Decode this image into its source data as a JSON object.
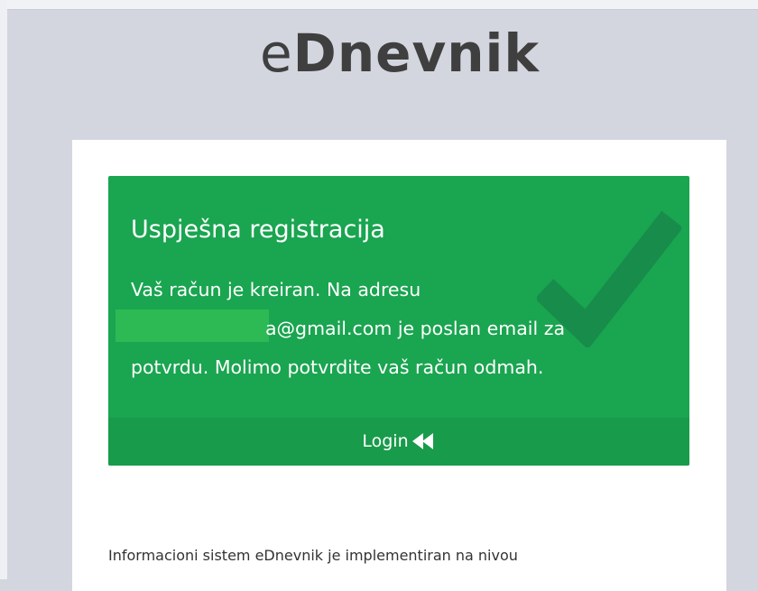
{
  "logo": {
    "prefix": "e",
    "name": "Dnevnik"
  },
  "alert": {
    "title": "Uspješna registracija",
    "message_line1": "Vaš račun je kreiran. Na adresu",
    "email_visible": "a@gmail.com",
    "message_line2_rest": " je poslan email za",
    "message_line3": "potvrdu. Molimo potvrdite vaš račun odmah.",
    "login_label": "Login",
    "login_icon": "double-chevron-left-icon",
    "background_icon": "checkmark-icon",
    "colors": {
      "background": "#1aa550",
      "footer": "#189b4a",
      "redaction": "#2dba55"
    }
  },
  "footer_text": "Informacioni sistem eDnevnik je implementiran na nivou",
  "colors": {
    "page_background": "#d3d6df",
    "card_background": "#ffffff"
  }
}
